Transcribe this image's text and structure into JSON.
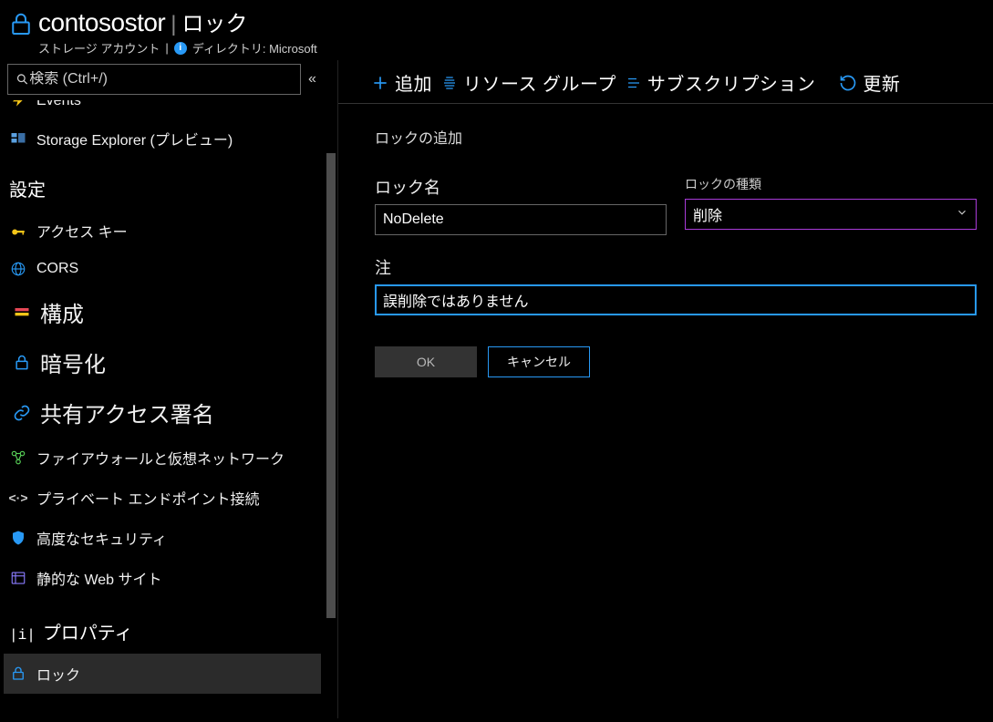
{
  "header": {
    "resource_name": "contosostor",
    "blade_title": "ロック",
    "resource_type": "ストレージ アカウント",
    "directory_label": "ディレクトリ: Microsoft"
  },
  "sidebar": {
    "search_placeholder": "検索 (Ctrl+/)",
    "cut_item": "Events",
    "items_top": [
      {
        "label": "Storage Explorer (プレビュー)",
        "icon": "storage-explorer-icon"
      }
    ],
    "section_settings": "設定",
    "items_settings": [
      {
        "label": "アクセス キー",
        "icon": "key-icon",
        "color": "#f5c518"
      },
      {
        "label": "CORS",
        "icon": "globe-icon",
        "color": "#2899f5"
      },
      {
        "label": "構成",
        "icon": "stack-icon",
        "color": "#e74856",
        "large": true
      },
      {
        "label": "暗号化",
        "icon": "lock-icon",
        "color": "#2899f5",
        "large": true
      },
      {
        "label": "共有アクセス署名",
        "icon": "link-icon",
        "color": "#2899f5",
        "large": true
      },
      {
        "label": "ファイアウォールと仮想ネットワーク",
        "icon": "firewall-icon",
        "color": "#5ad65a"
      },
      {
        "label": "プライベート エンドポイント接続",
        "icon": "brackets-icon",
        "color": "#cccccc"
      },
      {
        "label": "高度なセキュリティ",
        "icon": "shield-icon",
        "color": "#2899f5"
      },
      {
        "label": "静的な Web サイト",
        "icon": "webpage-icon",
        "color": "#8a7cff"
      }
    ],
    "item_properties": {
      "label": "プロパティ",
      "icon": "properties-icon"
    },
    "item_locks": {
      "label": "ロック",
      "icon": "lock-icon"
    }
  },
  "toolbar": {
    "add": "追加",
    "rg": "リソース グループ",
    "sub": "サブスクリプション",
    "refresh": "更新"
  },
  "form": {
    "panel_title": "ロックの追加",
    "name_label": "ロック名",
    "name_value": "NoDelete",
    "type_label": "ロックの種類",
    "type_value": "削除",
    "note_label": "注",
    "note_value": "誤削除ではありません",
    "ok": "OK",
    "cancel": "キャンセル"
  }
}
